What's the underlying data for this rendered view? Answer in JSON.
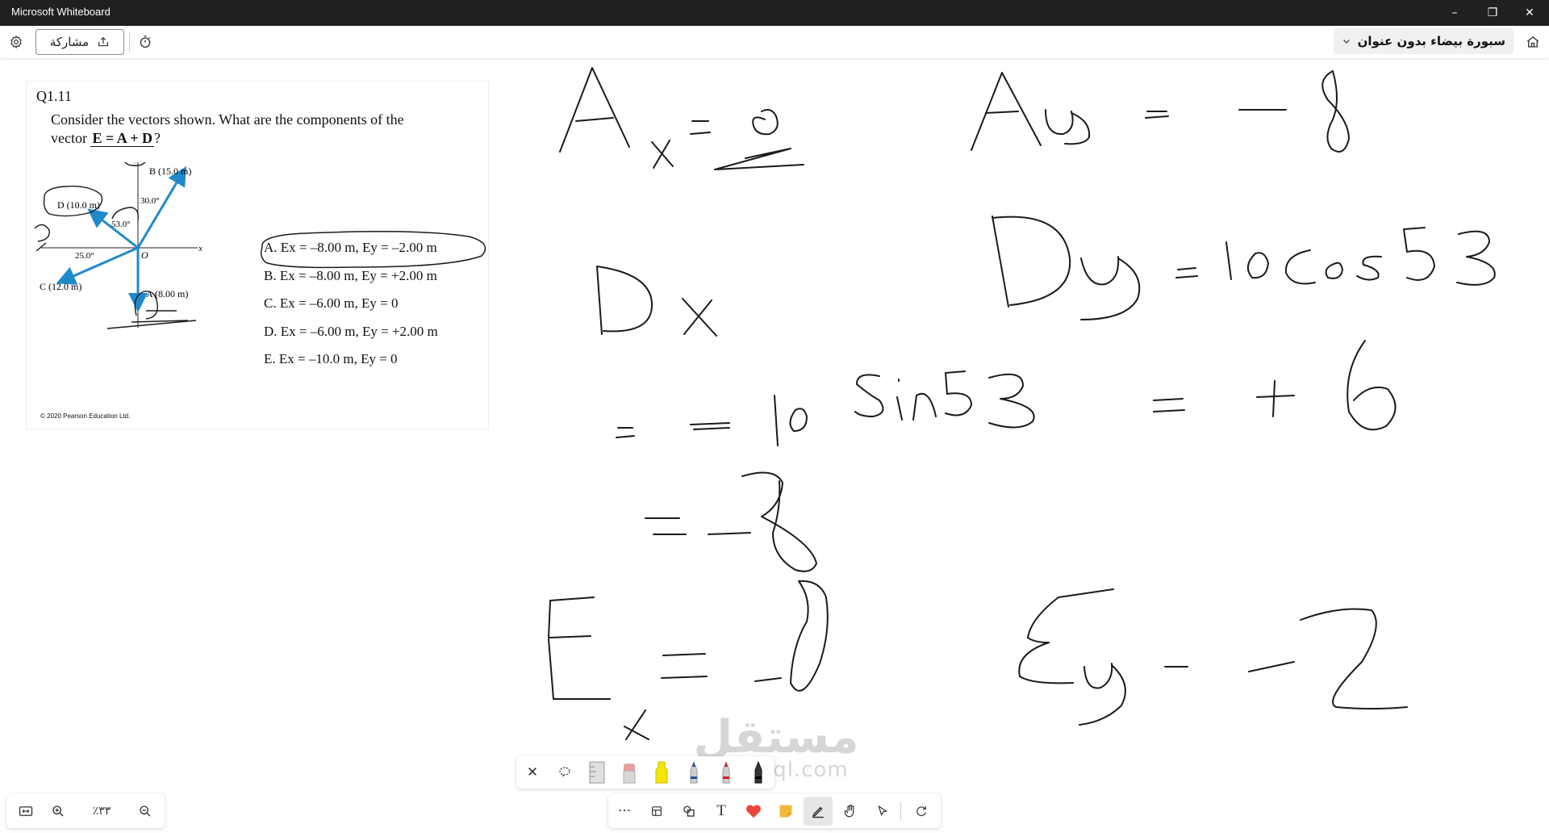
{
  "window": {
    "title": "Microsoft Whiteboard",
    "minimize_glyph": "–",
    "restore_glyph": "❐",
    "close_glyph": "✕"
  },
  "toolbar": {
    "share_label": "مشاركة",
    "board_name": "سبورة بيضاء بدون عنوان",
    "icons": [
      "settings-icon",
      "share-icon",
      "timer-icon",
      "chevron-down-icon",
      "home-icon"
    ]
  },
  "question": {
    "number": "Q1.11",
    "text_line1": "Consider the vectors shown. What are the components of the",
    "text_line2_prefix": "vector",
    "expression": "E = A + D",
    "expression_suffix": "?",
    "choices": [
      "A. Ex = –8.00 m, Ey = –2.00 m",
      "B. Ex = –8.00 m, Ey = +2.00 m",
      "C. Ex = –6.00 m, Ey = 0",
      "D. Ex = –6.00 m, Ey = +2.00 m",
      "E. Ex = –10.0 m, Ey = 0"
    ],
    "copyright": "© 2020 Pearson Education Ltd."
  },
  "diagram": {
    "axis_x": "x",
    "axis_y": "y",
    "origin": "O",
    "vectors": [
      {
        "name": "B",
        "label": "B (15.0 m)",
        "angle_label": "30.0°"
      },
      {
        "name": "D",
        "label": "D (10.0 m)",
        "angle_label": "53.0°"
      },
      {
        "name": "C",
        "label": "C (12.0 m)",
        "angle_label": "25.0°"
      },
      {
        "name": "A",
        "label": "A (8.00 m)"
      }
    ],
    "arrow_color": "#1f8ac9"
  },
  "handwriting": [
    "Ax = 0",
    "Ay = −8",
    "Dx",
    "Dy = 10Cos 53",
    "= −10 Sin53",
    "= +6",
    "= −8",
    "Ex = −8",
    "Ey = −2"
  ],
  "pen_tray": {
    "close_glyph": "✕",
    "tools": [
      "close-icon",
      "lasso-icon",
      "ruler-icon",
      "eraser-icon",
      "highlighter-yellow-icon",
      "pen-blue-icon",
      "pen-red-icon",
      "pen-black-icon"
    ]
  },
  "bottom_toolbar": {
    "more_glyph": "···",
    "text_glyph": "T",
    "tools": [
      "more-icon",
      "templates-icon",
      "shapes-icon",
      "text-icon",
      "reactions-icon",
      "sticky-note-icon",
      "inking-icon",
      "hand-icon",
      "select-icon",
      "redo-icon"
    ]
  },
  "zoom": {
    "level": "٪٣٣",
    "icons": [
      "fit-screen-icon",
      "zoom-in-icon",
      "zoom-out-icon"
    ]
  },
  "watermark": {
    "line1": "مستقل",
    "line2": "mostaql.com"
  },
  "colors": {
    "titlebar": "#202020",
    "ink": "#1a1a1a",
    "highlighter": "#f5e600",
    "accent": "#1f8ac9"
  }
}
